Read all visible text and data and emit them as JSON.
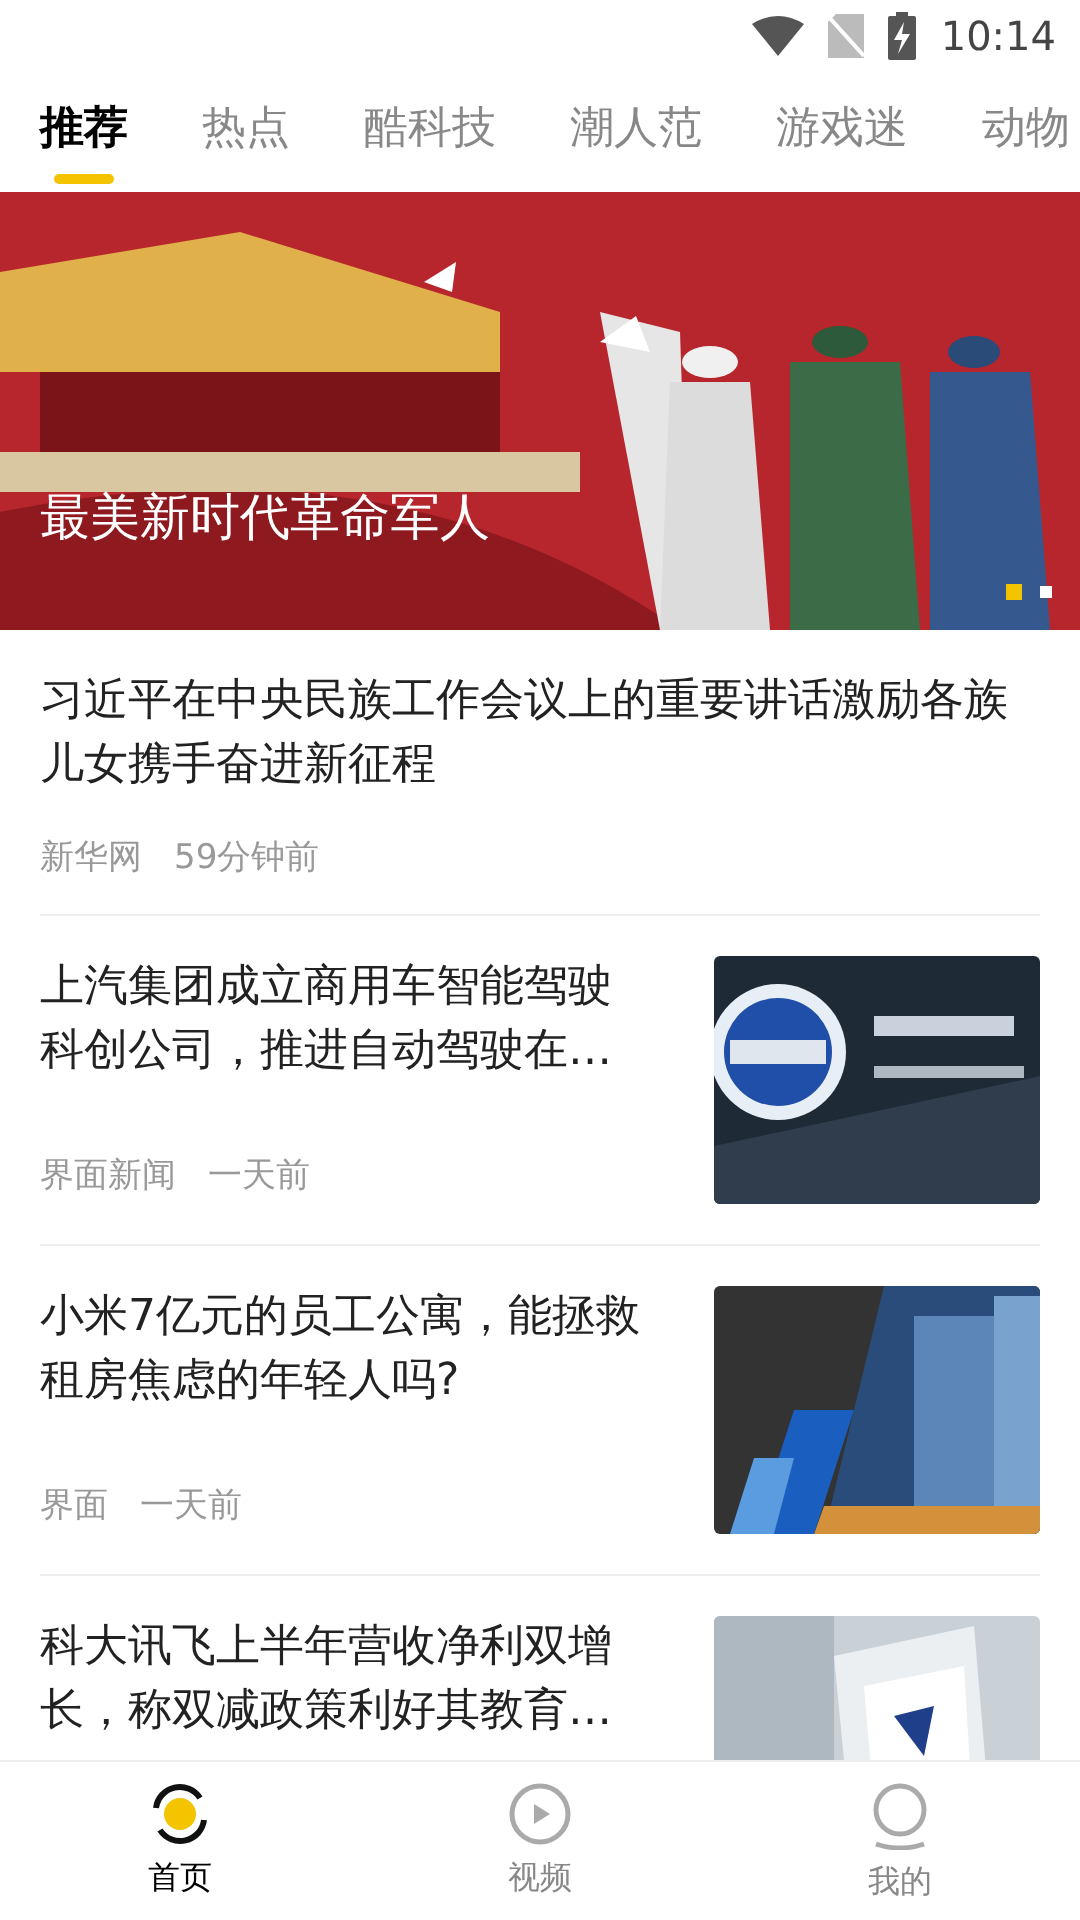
{
  "status_bar": {
    "time": "10:14"
  },
  "tabs": [
    {
      "label": "推荐",
      "selected": true
    },
    {
      "label": "热点",
      "selected": false
    },
    {
      "label": "酷科技",
      "selected": false
    },
    {
      "label": "潮人范",
      "selected": false
    },
    {
      "label": "游戏迷",
      "selected": false
    },
    {
      "label": "动物",
      "selected": false
    }
  ],
  "banner": {
    "title": "最美新时代革命军人",
    "dots": [
      {
        "selected": true
      },
      {
        "selected": false
      }
    ]
  },
  "articles": [
    {
      "kind": "text",
      "title": "习近平在中央民族工作会议上的重要讲话激励各族儿女携手奋进新征程",
      "source": "新华网",
      "time": "59分钟前"
    },
    {
      "kind": "thumb",
      "title": "上汽集团成立商用车智能驾驶科创公司，推进自动驾驶在…",
      "source": "界面新闻",
      "time": "一天前"
    },
    {
      "kind": "thumb",
      "title": "小米7亿元的员工公寓，能拯救租房焦虑的年轻人吗?",
      "source": "界面",
      "time": "一天前"
    },
    {
      "kind": "thumb",
      "title": "科大讯飞上半年营收净利双增长，称双减政策利好其教育…"
    }
  ],
  "bottom_nav": [
    {
      "label": "首页",
      "kind": "home",
      "selected": true
    },
    {
      "label": "视频",
      "kind": "video",
      "selected": false
    },
    {
      "label": "我的",
      "kind": "me",
      "selected": false
    }
  ]
}
